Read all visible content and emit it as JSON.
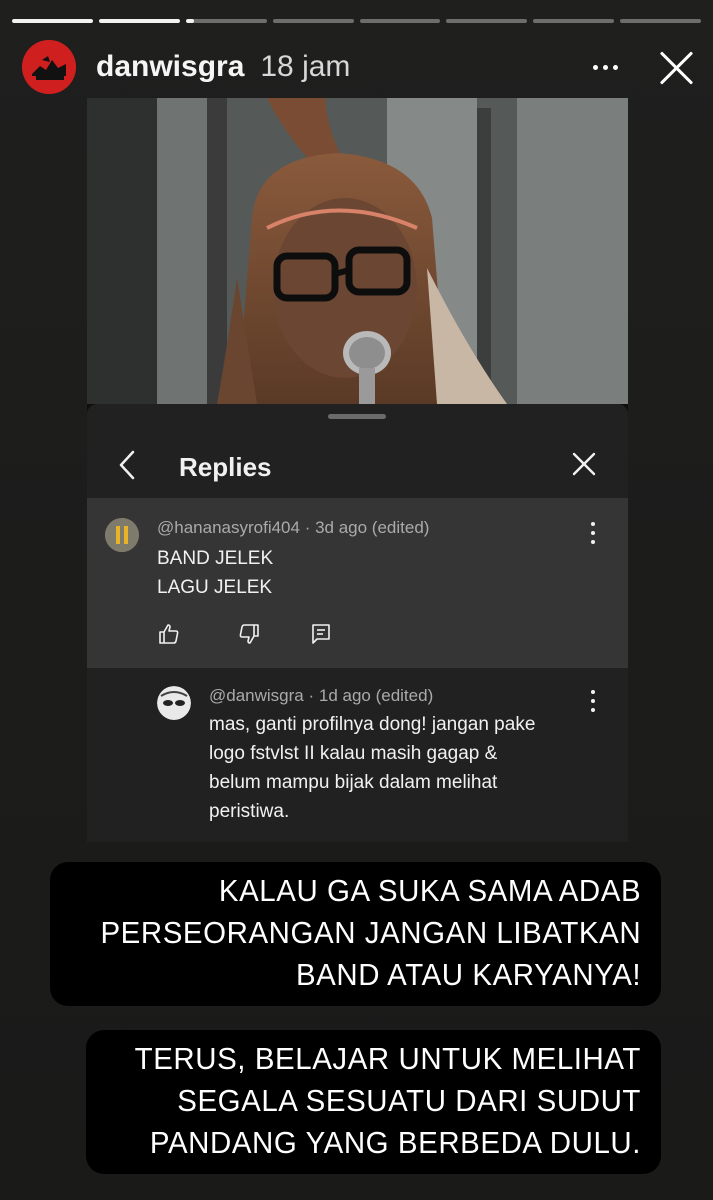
{
  "story": {
    "progress": [
      1,
      1,
      0.1,
      0,
      0,
      0,
      0,
      0
    ],
    "username": "danwisgra",
    "time": "18 jam",
    "icons": {
      "more": "more-horizontal-icon",
      "close": "close-icon"
    }
  },
  "screenshot": {
    "sheet_title": "Replies",
    "comments": [
      {
        "handle": "@hananasyrofi404",
        "meta": "· 3d ago (edited)",
        "text": "BAND JELEK\nLAGU JELEK",
        "actions": [
          "like-icon",
          "dislike-icon",
          "reply-icon"
        ]
      },
      {
        "handle": "@danwisgra",
        "meta": "· 1d ago (edited)",
        "text": "mas, ganti profilnya dong!  jangan pake\nlogo fstvlst II kalau masih gagap &\nbelum mampu bijak dalam melihat\nperistiwa."
      }
    ]
  },
  "captions": [
    [
      "KALAU GA SUKA SAMA ADAB",
      "PERSEORANGAN JANGAN LIBATKAN",
      "BAND ATAU KARYANYA!"
    ],
    [
      "TERUS, BELAJAR UNTUK MELIHAT",
      "SEGALA SESUATU DARI SUDUT",
      "PANDANG YANG BERBEDA DULU."
    ]
  ],
  "colors": {
    "avatar_red": "#cf1f1f",
    "sheet_bg": "#212121",
    "highlight_bg": "#353535",
    "caption_bg": "#000000"
  }
}
